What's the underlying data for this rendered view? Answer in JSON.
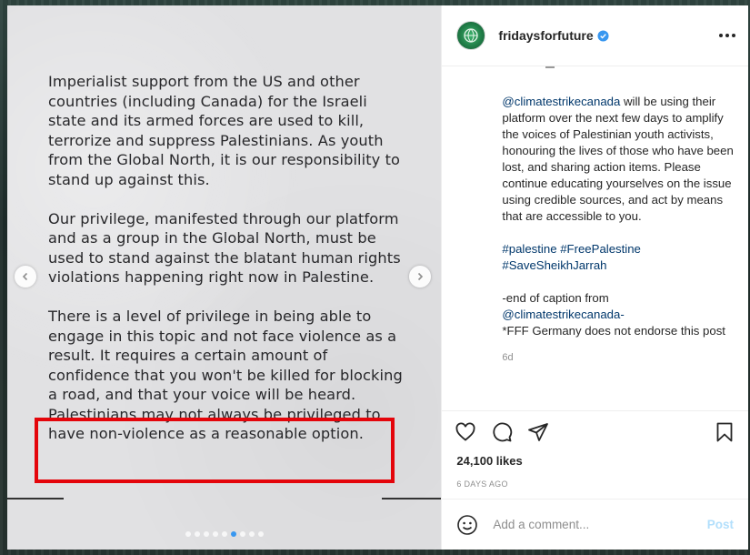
{
  "post_image": {
    "paragraphs": [
      "Imperialist support from the US and other countries (including Canada) for the Israeli state and its armed forces are used to kill, terrorize and suppress Palestinians. As youth from the Global North, it is our responsibility to stand up against this.",
      "Our privilege, manifested through our platform and as a group in the Global North, must be used to stand against the blatant human rights violations happening right now in Palestine.",
      "There is a level of privilege in being able to engage in this topic and not face violence as a result. It requires a certain amount of confidence that you won't be killed for blocking a road, and that your voice will be heard. Palestinians may not always be privileged to have non-violence as a reasonable option."
    ],
    "carousel_dots": 9,
    "active_dot": 5,
    "highlight_color": "#e4050b"
  },
  "header": {
    "username": "fridaysforfuture",
    "verified_icon": "verified-badge-icon",
    "more_icon": "more-options-icon"
  },
  "caption": {
    "mention1": "@climatestrikecanada",
    "body": " will be using their platform over the next few days to amplify the voices of Palestinian youth activists, honouring the lives of those who have been lost, and sharing action items. Please continue educating yourselves on the issue using credible sources, and act by means that are accessible to you.",
    "tags": "#palestine #FreePalestine #SaveSheikhJarrah",
    "end_line": "-end of caption from",
    "mention2": "@climatestrikecanada-",
    "disclaimer": "*FFF Germany does not endorse this post",
    "age": "6d"
  },
  "actions": {
    "icons": [
      "heart-icon",
      "comment-icon",
      "share-icon",
      "bookmark-icon"
    ],
    "likes": "24,100 likes",
    "posted": "6 DAYS AGO"
  },
  "comment": {
    "placeholder": "Add a comment...",
    "post_label": "Post",
    "emoji_icon": "emoji-icon"
  },
  "colors": {
    "accent": "#3897f0",
    "link": "#00376b",
    "post_disabled": "#b2dffc"
  }
}
